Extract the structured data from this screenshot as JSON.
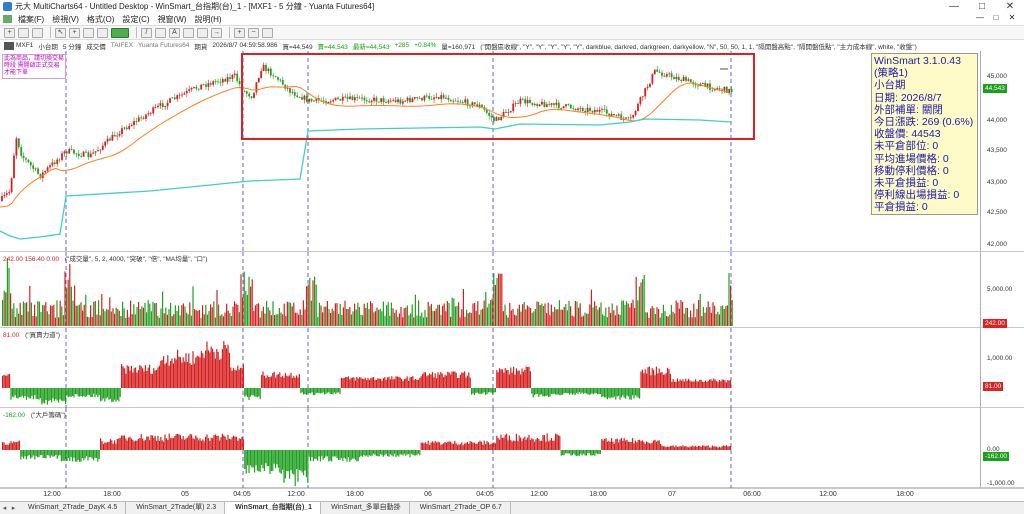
{
  "window": {
    "title": "元大 MultiCharts64 - Untitled Desktop - WinSmart_台指期(台)_1 - [MXF1 - 5 分鐘 - Yuanta Futures64]",
    "controls": [
      "—",
      "□",
      "✕"
    ]
  },
  "menu": {
    "items": [
      "檔案(F)",
      "檢視(V)",
      "格式(O)",
      "設定(C)",
      "視窗(W)",
      "說明(H)"
    ],
    "right": [
      "—",
      "□",
      "✕"
    ]
  },
  "chart_header": {
    "symbol": "MXF1",
    "name": "小台期",
    "interval": "5 分鐘",
    "type": "成交價",
    "exchange": "TAIFEX",
    "feed": "Yuanta Futures64",
    "period": "期貨",
    "datetime": "2026/8/7  04:59:58.986",
    "bid": "買=44,549",
    "ask": "賣=44,543",
    "last": "最新=44,543",
    "change": "+285",
    "change_pct": "+0.84%",
    "volume": "量=160,971",
    "study": "(\"開盤區收線\", \"Y\", \"Y\", \"Y\", \"Y\", \"Y\", darkblue, darkred, darkgreen, darkyellow, \"N\", 50, 50, 1, 1, \"隔開盤高點\", \"隔開盤低點\", \"主力成本線\", white, \"收盤\")"
  },
  "note": "此為商品，請切換交易時段 需開啟正式交易才能下單",
  "infobox": {
    "lines": [
      "WinSmart 3.1.0.43",
      "(策略1)",
      "小台期",
      "日期: 2026/8/7",
      "外部補單: 關閉",
      "今日漲跌: 269 (0.6%)",
      "收盤價: 44543",
      "未平倉部位: 0",
      "平均進場價格: 0",
      "移動停利價格: 0",
      "未平倉損益: 0",
      "停利線出場損益: 0",
      "平倉損益: 0"
    ]
  },
  "main_axis": {
    "ticks": [
      "45,000",
      "44,000",
      "43,500",
      "43,000",
      "42,500",
      "42,000"
    ],
    "last_label": "44,543"
  },
  "volume_panel": {
    "title": "(\"成交量\", 5, 2, 4000, \"突破\", \"倍\", \"MA均量\", \"口\")",
    "values": "242.00  156.40  0.00",
    "ticks": [
      "5,000.00"
    ],
    "last_label": "242.00"
  },
  "power_panel": {
    "title": "(\"買賣力道\")",
    "values": "81.00",
    "ticks": [
      "1,000.00"
    ],
    "last_label": "81.00"
  },
  "big_panel": {
    "title": "(\"大戶籌碼\")",
    "values": "-162.00",
    "ticks": [
      "0.00",
      "-1,000.00"
    ],
    "last_label": "-162.00"
  },
  "time_axis": [
    "12:00",
    "18:00",
    "05",
    "04:05",
    "12:00",
    "18:00",
    "06",
    "04:05",
    "12:00",
    "18:00",
    "07",
    "06:00",
    "12:00",
    "18:00"
  ],
  "tabs": [
    "WinSmart_2Trade_DayK 4.5",
    "WinSmart_2Trade(單) 2.3",
    "WinSmart_台指期(台)_1",
    "WinSmart_多單自動掛",
    "WinSmart_2Trade_OP 6.7"
  ],
  "colors": {
    "accent_green": "#4caf50",
    "red_candle": "#d62020",
    "green_candle": "#20a020",
    "orange_line": "#ff7f1f",
    "teal_line": "#40d0c0",
    "highlight": "#e02020",
    "infobox_bg": "#fffbc8",
    "infobox_text": "#1a1ab0"
  }
}
